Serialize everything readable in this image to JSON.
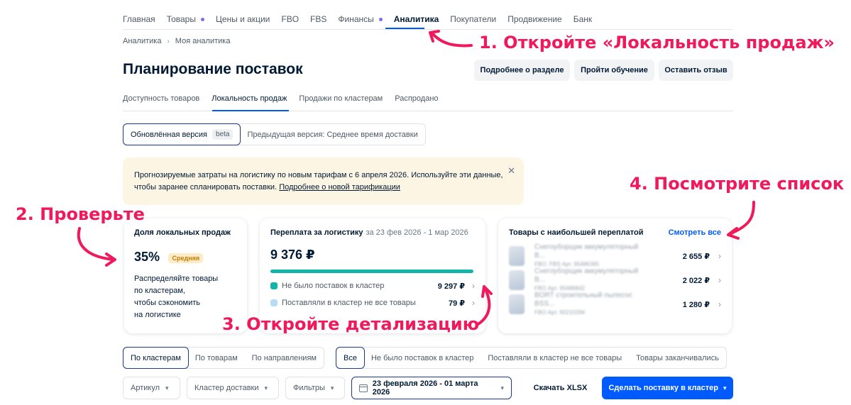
{
  "nav": {
    "items": [
      "Главная",
      "Товары",
      "Цены и акции",
      "FBO",
      "FBS",
      "Финансы",
      "Аналитика",
      "Покупатели",
      "Продвижение",
      "Банк"
    ]
  },
  "breadcrumb": {
    "root": "Аналитика",
    "current": "Моя аналитика",
    "sep": "›"
  },
  "page": {
    "title": "Планирование поставок"
  },
  "header_buttons": {
    "about": "Подробнее о разделе",
    "training": "Пройти обучение",
    "feedback": "Оставить отзыв"
  },
  "subtabs": [
    "Доступность товаров",
    "Локальность продаж",
    "Продажи по кластерам",
    "Распродано"
  ],
  "version_switch": {
    "new": "Обновлённая версия",
    "beta": "beta",
    "prev": "Предыдущая версия: Среднее время доставки"
  },
  "alert": {
    "line1": "Прогнозируемые затраты на логистику по новым тарифам с 6 апреля 2026. Используйте эти данные,",
    "line2": "чтобы заранее спланировать поставки.",
    "link": "Подробнее о новой тарификации",
    "close": "✕"
  },
  "card_local": {
    "title": "Доля локальных продаж",
    "value": "35%",
    "badge": "Средняя",
    "desc1": "Распределяйте товары",
    "desc2": "по кластерам,",
    "desc3": "чтобы сэкономить",
    "desc4": "на логистике"
  },
  "card_overpay": {
    "title": "Переплата за логистику",
    "period": "за 23 фев 2026 - 1 мар 2026",
    "total": "9 376 ₽",
    "rows": [
      {
        "label": "Не было поставок в кластер",
        "value": "9 297 ₽",
        "color": "#13b5a9"
      },
      {
        "label": "Поставляли в кластер не все товары",
        "value": "79 ₽",
        "color": "#b8dcf5"
      }
    ]
  },
  "card_products": {
    "title": "Товары с наибольшей переплатой",
    "see_all": "Смотреть все",
    "items": [
      {
        "name": "Снегоуборщик аккумуляторный B...",
        "meta": "FBO, FBS Арт. 95486365",
        "price": "2 655 ₽"
      },
      {
        "name": "Снегоуборщик аккумуляторный B...",
        "meta": "FBO Арт. 95486842",
        "price": "2 022 ₽"
      },
      {
        "name": "BORT строительный пылесос BSS...",
        "meta": "FBO Арт. 90210284",
        "price": "1 280 ₽"
      }
    ]
  },
  "group_segment": [
    "По кластерам",
    "По товарам",
    "По направлениям"
  ],
  "filter_segment": [
    "Все",
    "Не было поставок в кластер",
    "Поставляли в кластер не все товары",
    "Товары заканчивались"
  ],
  "filters": {
    "article": "Артикул",
    "cluster": "Кластер доставки",
    "filters": "Фильтры",
    "date": "23 февраля 2026 - 01 марта 2026",
    "xlsx": "Скачать XLSX",
    "make": "Сделать поставку в кластер"
  },
  "annotations": {
    "a1": "1. Откройте «Локальность продаж»",
    "a2": "2. Проверьте",
    "a3": "3. Откройте детализацию",
    "a4": "4. Посмотрите список",
    "color": "#f0195c"
  },
  "colors": {
    "accent": "#005bff",
    "teal": "#13b5a9",
    "alert_bg": "#fdf5e3"
  }
}
